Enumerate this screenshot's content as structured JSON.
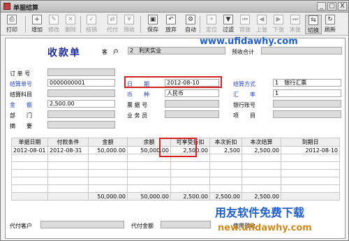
{
  "window": {
    "title": "单据结算",
    "buttons": [
      "_",
      "□",
      "X"
    ]
  },
  "toolbar": [
    {
      "name": "print",
      "label": "打印",
      "glyph": "⎙",
      "disabled": false
    },
    {
      "name": "add",
      "label": "增加",
      "glyph": "+",
      "disabled": false
    },
    {
      "name": "modify",
      "label": "修改",
      "glyph": "✎",
      "disabled": true
    },
    {
      "name": "delete",
      "label": "删除",
      "glyph": "✕",
      "disabled": true
    },
    {
      "name": "verify",
      "label": "核销",
      "glyph": "✓",
      "disabled": true
    },
    {
      "name": "agent-pay",
      "label": "代付",
      "glyph": "⇄",
      "disabled": true
    },
    {
      "name": "prepay",
      "label": "预收",
      "glyph": "¥",
      "disabled": true
    },
    {
      "name": "save",
      "label": "保存",
      "glyph": "▣",
      "disabled": false
    },
    {
      "name": "discard",
      "label": "放弃",
      "glyph": "↶",
      "disabled": false
    },
    {
      "name": "auto",
      "label": "自动",
      "glyph": "⚙",
      "disabled": false
    },
    {
      "name": "locate",
      "label": "定位",
      "glyph": "⌖",
      "disabled": true
    },
    {
      "name": "filter",
      "label": "过滤",
      "glyph": "▼",
      "disabled": false
    },
    {
      "name": "first",
      "label": "首张",
      "glyph": "⏮",
      "disabled": true
    },
    {
      "name": "prev",
      "label": "上张",
      "glyph": "◀",
      "disabled": true
    },
    {
      "name": "next",
      "label": "下张",
      "glyph": "▶",
      "disabled": true
    },
    {
      "name": "last",
      "label": "末张",
      "glyph": "⏭",
      "disabled": true
    },
    {
      "name": "switch",
      "label": "切换",
      "glyph": "⇆",
      "disabled": false,
      "selected": true
    },
    {
      "name": "refresh",
      "label": "刷新",
      "glyph": "↻",
      "disabled": false
    }
  ],
  "form": {
    "title": "收款单",
    "customer_label": "客　户",
    "customer_value": "2　利天实业",
    "prepay_total_label": "预收合计",
    "watermark_top": "www.ufidawhy.com",
    "order_no_label": "订 单 号",
    "settle_no_label": "结算单号",
    "settle_no_value": "0000000001",
    "settle_subject_label": "结算科目",
    "amount_label": "金　　额",
    "amount_value": "2,500.00",
    "dept_label": "部　　门",
    "summary_label": "摘　　要",
    "date_label": "日　　期",
    "date_value": "2012-08-10",
    "currency_label": "币　　种",
    "currency_value": "人民币",
    "bill_no_label": "票 据 号",
    "salesman_label": "业 务 员",
    "settle_method_label": "结算方式",
    "settle_method_value": "1　银行汇票",
    "rate_label": "汇　　率",
    "rate_value": "1",
    "bank_account_label": "银行账号",
    "project_label": "项　　目"
  },
  "grid": {
    "columns": [
      "单据日期",
      "付款条件",
      "金额",
      "余额",
      "可享受折扣",
      "本次折扣",
      "本次结算",
      "到期日"
    ],
    "rows": [
      [
        "2012-08-01",
        "2012-08-31",
        "50,000.00",
        "50,000.00",
        "2,500.00",
        "2,500",
        "2,500.00",
        "2012-08-10"
      ]
    ],
    "totals": [
      "",
      "",
      "50,000.00",
      "50,000.00",
      "2,500.00",
      "2,500.00",
      "2,500.00",
      ""
    ]
  },
  "footer": {
    "agent_customer_label": "代付客户",
    "agent_amount_label": "代付金额",
    "use_prepay_label": "使用预收",
    "watermark_cn": "用友软件免费下载",
    "watermark_url": "new.ufidawhy.com"
  }
}
